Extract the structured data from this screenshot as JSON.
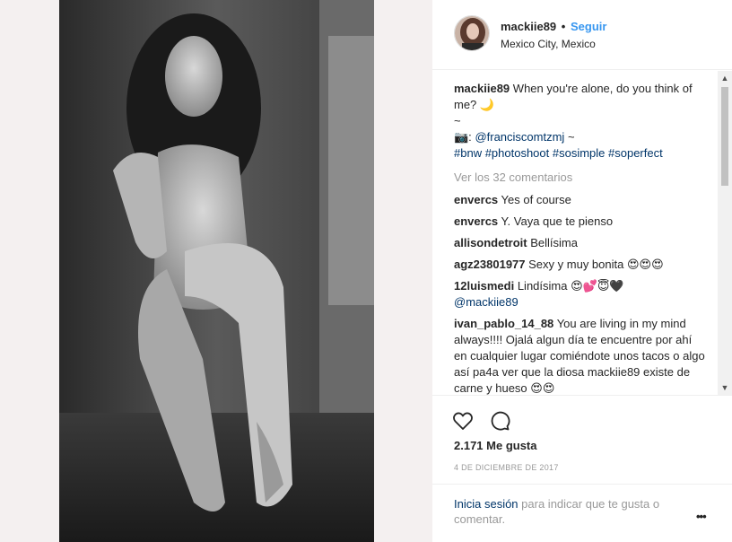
{
  "post": {
    "username": "mackiie89",
    "separator": "•",
    "follow_label": "Seguir",
    "location": "Mexico City, Mexico"
  },
  "caption": {
    "username": "mackiie89",
    "text": "When you're alone, do you think of me? 🌙",
    "tilde": "~",
    "camera": "📷:",
    "photographer": "@franciscomtzmj",
    "tilde2": "~",
    "hashtags": "#bnw #photoshoot #sosimple #soperfect"
  },
  "view_comments_label": "Ver los 32 comentarios",
  "comments": [
    {
      "user": "envercs",
      "text": "Yes of course"
    },
    {
      "user": "envercs",
      "text": "Y. Vaya que te pienso"
    },
    {
      "user": "allisondetroit",
      "text": "Bellísima"
    },
    {
      "user": "agz23801977",
      "text": "Sexy y muy bonita 😍😍😍"
    },
    {
      "user": "12luismedi",
      "text": "Lindísima 😍💕😇🖤",
      "mention": "@mackiie89"
    },
    {
      "user": "ivan_pablo_14_88",
      "text": "You are living in my mind always!!!! Ojalá algun día te encuentre por ahí en cualquier lugar comiéndote unos tacos o algo así pa4a ver que la diosa mackiie89 existe de carne y hueso 😍😍"
    }
  ],
  "likes": "2.171 Me gusta",
  "date": "4 DE DICIEMBRE DE 2017",
  "login": {
    "link": "Inicia sesión",
    "text": "para indicar que te gusta o comentar."
  },
  "options_label": "•••",
  "scroll": {
    "up": "▲",
    "down": "▼",
    "position": 0
  }
}
